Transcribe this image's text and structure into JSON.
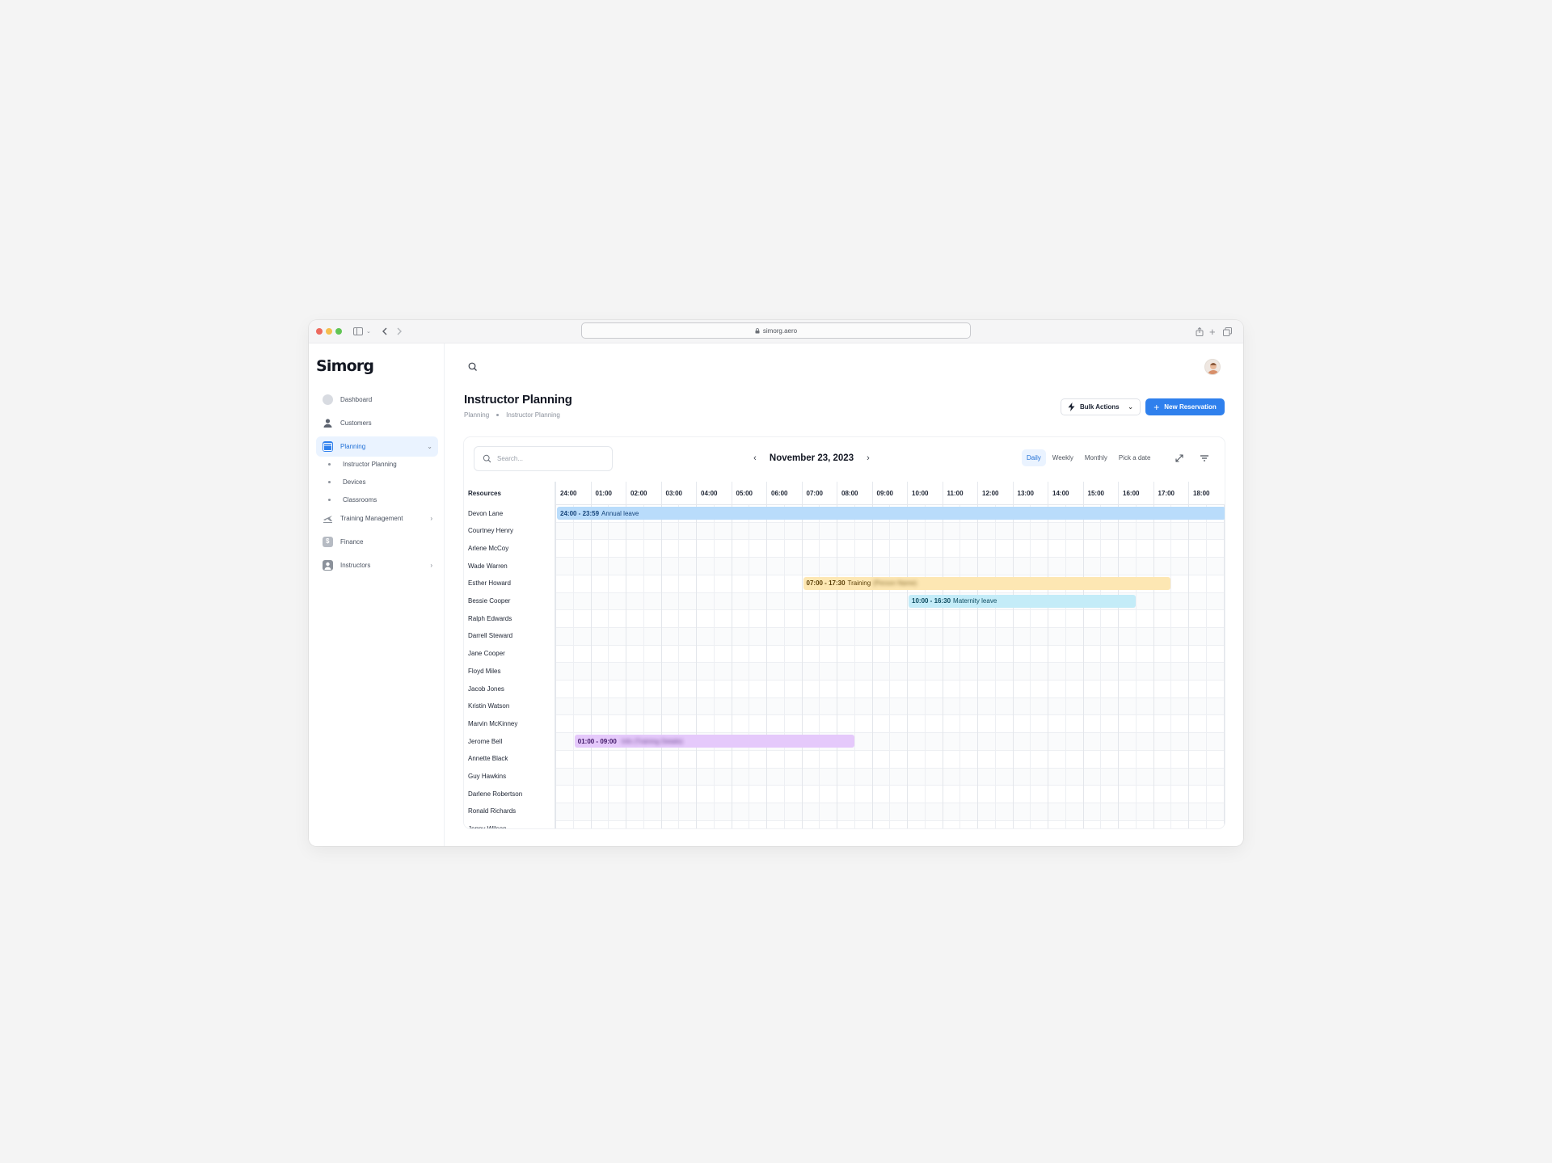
{
  "browser": {
    "url": "simorg.aero"
  },
  "app": {
    "logo": "Simorg"
  },
  "sidebar": {
    "items": [
      {
        "label": "Dashboard",
        "icon": "dashboard-icon"
      },
      {
        "label": "Customers",
        "icon": "users-icon"
      },
      {
        "label": "Planning",
        "icon": "calendar-icon",
        "active": true,
        "expanded": true
      },
      {
        "label": "Training Management",
        "icon": "plane-icon"
      },
      {
        "label": "Finance",
        "icon": "finance-icon"
      },
      {
        "label": "Instructors",
        "icon": "instructor-icon"
      }
    ],
    "planning_sub": [
      {
        "label": "Instructor Planning",
        "active": true
      },
      {
        "label": "Devices"
      },
      {
        "label": "Classrooms"
      }
    ]
  },
  "header": {
    "title": "Instructor Planning",
    "breadcrumb": [
      "Planning",
      "Instructor Planning"
    ],
    "bulk_actions_label": "Bulk Actions",
    "new_reservation_label": "New Reservation"
  },
  "calendar": {
    "search_placeholder": "Search...",
    "date": "November 23, 2023",
    "views": [
      "Daily",
      "Weekly",
      "Monthly",
      "Pick a date"
    ],
    "active_view": "Daily",
    "resources_header": "Resources",
    "hours": [
      "24:00",
      "01:00",
      "02:00",
      "03:00",
      "04:00",
      "05:00",
      "06:00",
      "07:00",
      "08:00",
      "09:00",
      "10:00",
      "11:00",
      "12:00",
      "13:00",
      "14:00",
      "15:00",
      "16:00",
      "17:00",
      "18:00"
    ],
    "resources": [
      "Devon Lane",
      "Courtney Henry",
      "Arlene McCoy",
      "Wade Warren",
      "Esther Howard",
      "Bessie Cooper",
      "Ralph Edwards",
      "Darrell Steward",
      "Jane Cooper",
      "Floyd Miles",
      "Jacob Jones",
      "Kristin Watson",
      "Marvin McKinney",
      "Jerome Bell",
      "Annette Black",
      "Guy Hawkins",
      "Darlene Robertson",
      "Ronald Richards",
      "Jenny Wilson"
    ],
    "events": [
      {
        "row": 0,
        "start": 0,
        "end": 24,
        "time": "24:00 - 23:59",
        "label": "Annual leave",
        "blurred": "",
        "color": "#b9dcfb",
        "cls": "ev-blue"
      },
      {
        "row": 4,
        "start": 7,
        "end": 17.5,
        "time": "07:00 - 17:30",
        "label": "Training",
        "blurred": "(Person Name)",
        "color": "#fde7b3",
        "cls": "ev-amber"
      },
      {
        "row": 5,
        "start": 10,
        "end": 16.5,
        "time": "10:00 - 16:30",
        "label": "Maternity leave",
        "blurred": "",
        "color": "#c4ecf8",
        "cls": "ev-cyan"
      },
      {
        "row": 13,
        "start": 0.5,
        "end": 8.5,
        "time": "01:00 - 09:00",
        "label": "",
        "blurred": "Info (Training Details)",
        "color": "#e5c9fb",
        "cls": "ev-purple"
      }
    ]
  },
  "colors": {
    "accent": "#2f80ed",
    "sidebar_active_bg": "#eaf3ff"
  }
}
